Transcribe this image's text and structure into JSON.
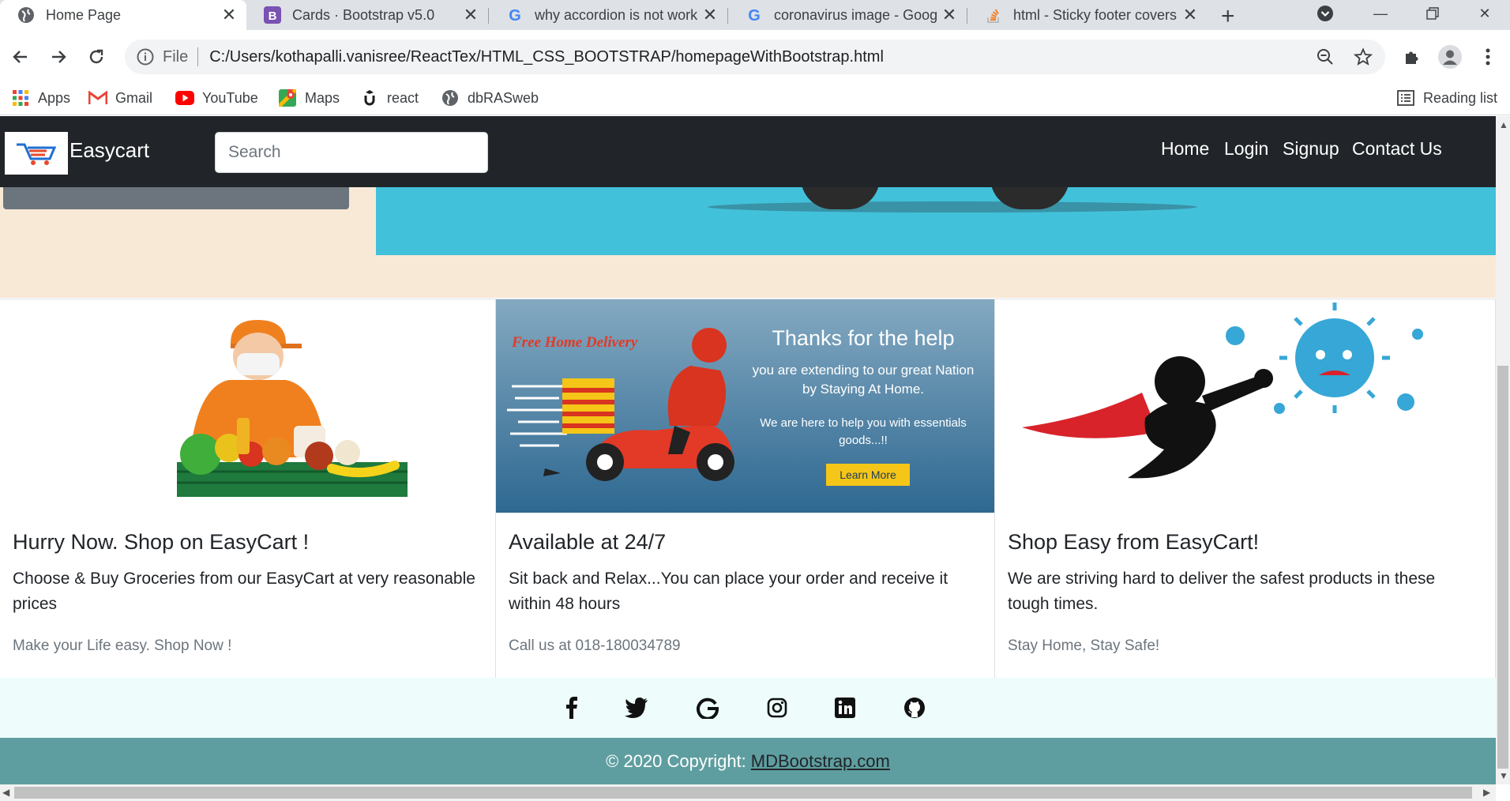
{
  "browser": {
    "tabs": [
      {
        "title": "Home Page",
        "active": true
      },
      {
        "title": "Cards · Bootstrap v5.0",
        "active": false
      },
      {
        "title": "why accordion is not work",
        "active": false
      },
      {
        "title": "coronavirus image - Goog",
        "active": false
      },
      {
        "title": "html - Sticky footer covers",
        "active": false
      }
    ],
    "address": {
      "scheme_label": "File",
      "url": "C:/Users/kothapalli.vanisree/ReactTex/HTML_CSS_BOOTSTRAP/homepageWithBootstrap.html"
    },
    "bookmarks": [
      "Apps",
      "Gmail",
      "YouTube",
      "Maps",
      "react",
      "dbRASweb"
    ],
    "reading_list": "Reading list"
  },
  "navbar": {
    "brand": "Easycart",
    "search_placeholder": "Search",
    "links": [
      "Home",
      "Login",
      "Signup",
      "Contact Us"
    ]
  },
  "cards": [
    {
      "title": "Hurry Now. Shop on EasyCart !",
      "text": "Choose & Buy Groceries from our EasyCart at very reasonable prices",
      "muted": "Make your Life easy. Shop Now !"
    },
    {
      "title": "Available at 24/7",
      "text": "Sit back and Relax...You can place your order and receive it within 48 hours",
      "muted": "Call us at 018-180034789",
      "banner": {
        "tag": "Free Home Delivery",
        "heading": "Thanks for the help",
        "line1": "you are extending to our great Nation",
        "line2": "by Staying At Home.",
        "line3": "We are here to help you with essentials",
        "line4": "goods...!!",
        "button": "Learn More"
      }
    },
    {
      "title": "Shop Easy from EasyCart!",
      "text": "We are striving hard to deliver the safest products in these tough times.",
      "muted": "Stay Home, Stay Safe!"
    }
  ],
  "footer": {
    "social_icons": [
      "facebook-icon",
      "twitter-icon",
      "google-icon",
      "instagram-icon",
      "linkedin-icon",
      "github-icon"
    ],
    "copyright_prefix": "© 2020 Copyright:",
    "copyright_link": "MDBootstrap.com"
  },
  "colors": {
    "navbar": "#212529",
    "hero_cyan": "#42c1da",
    "hero_band": "#f8e9d6",
    "footer_teal": "#5f9ea0",
    "social_bg": "#eefcfc"
  }
}
